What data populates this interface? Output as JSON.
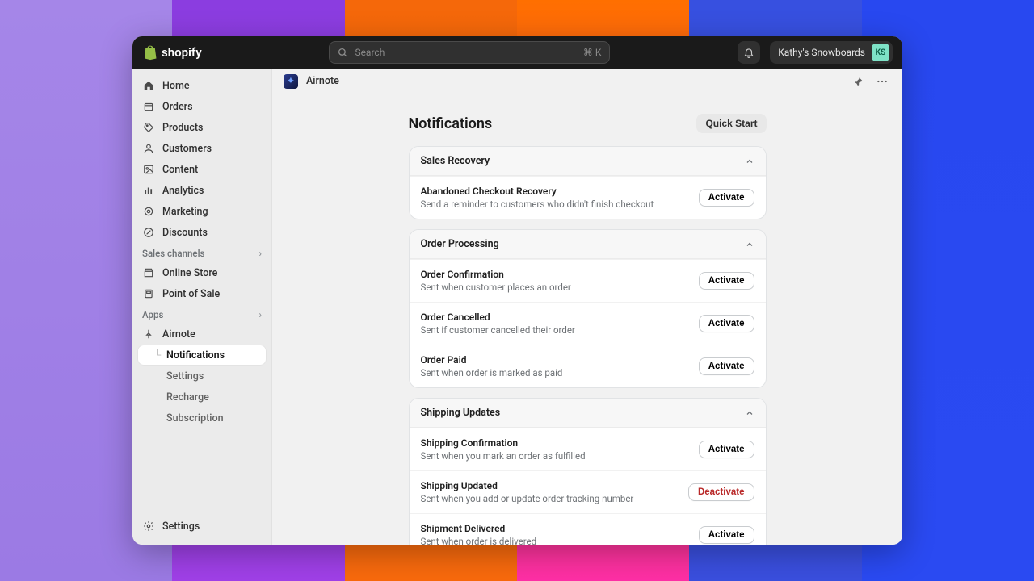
{
  "brand": "shopify",
  "search": {
    "placeholder": "Search",
    "kbd": "⌘ K"
  },
  "store_name": "Kathy's Snowboards",
  "avatar_initials": "KS",
  "sidebar": {
    "items": [
      {
        "label": "Home"
      },
      {
        "label": "Orders"
      },
      {
        "label": "Products"
      },
      {
        "label": "Customers"
      },
      {
        "label": "Content"
      },
      {
        "label": "Analytics"
      },
      {
        "label": "Marketing"
      },
      {
        "label": "Discounts"
      }
    ],
    "sales_channels_label": "Sales channels",
    "sales_items": [
      {
        "label": "Online Store"
      },
      {
        "label": "Point of Sale"
      }
    ],
    "apps_label": "Apps",
    "app_item": {
      "label": "Airnote"
    },
    "app_sub": [
      {
        "label": "Notifications"
      },
      {
        "label": "Settings"
      },
      {
        "label": "Recharge"
      },
      {
        "label": "Subscription"
      }
    ],
    "settings_label": "Settings"
  },
  "breadcrumb": {
    "app": "Airnote"
  },
  "page": {
    "title": "Notifications",
    "quick_start": "Quick Start"
  },
  "actions": {
    "activate": "Activate",
    "deactivate": "Deactivate"
  },
  "sections": [
    {
      "title": "Sales Recovery",
      "rows": [
        {
          "title": "Abandoned Checkout Recovery",
          "desc": "Send a reminder to customers who didn't finish checkout",
          "action": "activate"
        }
      ]
    },
    {
      "title": "Order Processing",
      "rows": [
        {
          "title": "Order Confirmation",
          "desc": "Sent when customer places an order",
          "action": "activate"
        },
        {
          "title": "Order Cancelled",
          "desc": "Sent if customer cancelled their order",
          "action": "activate"
        },
        {
          "title": "Order Paid",
          "desc": "Sent when order is marked as paid",
          "action": "activate"
        }
      ]
    },
    {
      "title": "Shipping Updates",
      "rows": [
        {
          "title": "Shipping Confirmation",
          "desc": "Sent when you mark an order as fulfilled",
          "action": "activate"
        },
        {
          "title": "Shipping Updated",
          "desc": "Sent when you add or update order tracking number",
          "action": "deactivate"
        },
        {
          "title": "Shipment Delivered",
          "desc": "Sent when order is delivered",
          "action": "activate"
        }
      ]
    }
  ]
}
